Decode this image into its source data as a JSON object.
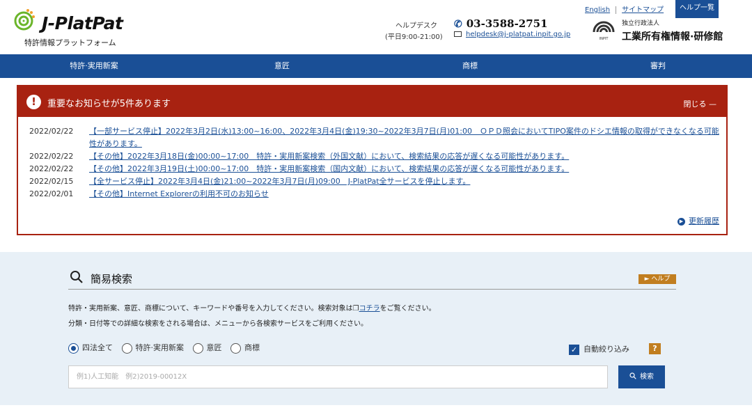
{
  "header": {
    "logo_text": "J-PlatPat",
    "logo_subtitle": "特許情報プラットフォーム",
    "helpdesk_label": "ヘルプデスク",
    "helpdesk_hours": "(平日9:00-21:00)",
    "phone": "03-3588-2751",
    "email": "helpdesk@j-platpat.inpit.go.jp",
    "link_english": "English",
    "link_sitemap": "サイトマップ",
    "help_list": "ヘルプ一覧",
    "org_small": "独立行政法人",
    "org_name": "工業所有権情報·研修館",
    "org_logo_text": "INPIT"
  },
  "nav": {
    "items": [
      {
        "label": "特許·実用新案"
      },
      {
        "label": "意匠"
      },
      {
        "label": "商標"
      },
      {
        "label": "審判"
      }
    ]
  },
  "notice": {
    "title": "重要なお知らせが5件あります",
    "close_label": "閉じる —",
    "items": [
      {
        "date": "2022/02/22",
        "text": "【一部サービス停止】2022年3月2日(水)13:00~16:00、2022年3月4日(金)19:30~2022年3月7日(月)01:00　ＯＰＤ照会においてTIPO案件のドシエ情報の取得ができなくなる可能性があります。"
      },
      {
        "date": "2022/02/22",
        "text": "【その他】2022年3月18日(金)00:00~17:00　特許・実用新案検索（外国文献）において、検索結果の応答が遅くなる可能性があります。"
      },
      {
        "date": "2022/02/22",
        "text": "【その他】2022年3月19日(土)00:00~17:00　特許・実用新案検索（国内文献）において、検索結果の応答が遅くなる可能性があります。"
      },
      {
        "date": "2022/02/15",
        "text": "【全サービス停止】2022年3月4日(金)21:00~2022年3月7日(月)09:00　J-PlatPat全サービスを停止します。"
      },
      {
        "date": "2022/02/01",
        "text": "【その他】Internet Explorerの利用不可のお知らせ"
      }
    ],
    "history_label": "更新履歴"
  },
  "search": {
    "title": "簡易検索",
    "help_chip": "► ヘルプ",
    "desc1_pre": "特許・実用新案、意匠、商標について、キーワードや番号を入力してください。検索対象は",
    "desc1_link": "コチラ",
    "desc1_post": "をご覧ください。",
    "desc2": "分類・日付等での詳細な検索をされる場合は、メニューから各検索サービスをご利用ください。",
    "radios": [
      {
        "label": "四法全て",
        "checked": true
      },
      {
        "label": "特許·実用新案",
        "checked": false
      },
      {
        "label": "意匠",
        "checked": false
      },
      {
        "label": "商標",
        "checked": false
      }
    ],
    "auto_filter_label": "自動絞り込み",
    "auto_filter_checked": true,
    "question_mark": "?",
    "input_placeholder": "例1)人工知能　例2)2019-00012X",
    "input_value": "",
    "button_label": "検索"
  },
  "colors": {
    "brand_blue": "#1a4f96",
    "notice_red": "#a82211",
    "accent_orange": "#c17e20",
    "panel_bg": "#e8f0f7"
  }
}
